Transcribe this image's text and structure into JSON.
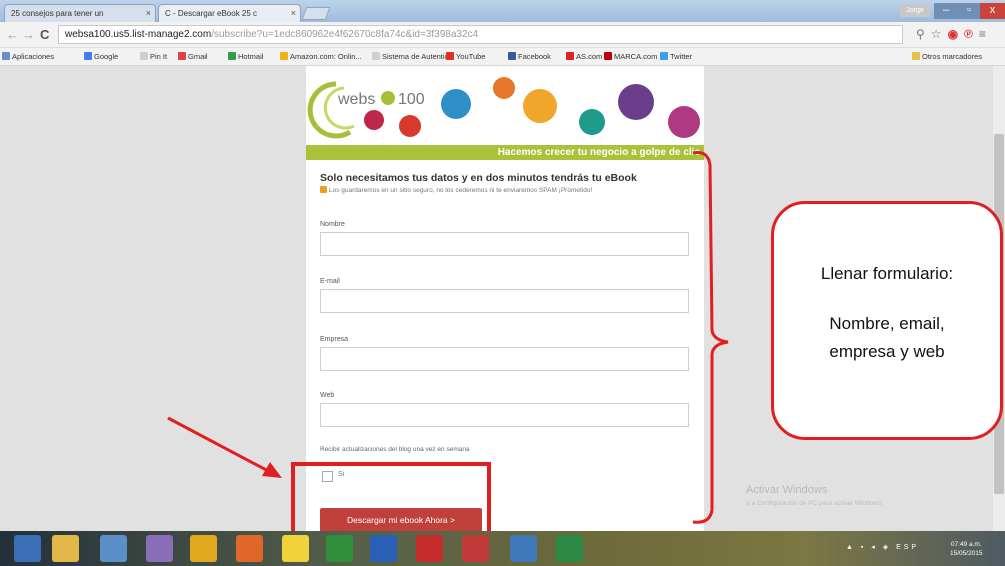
{
  "browser": {
    "tabs": [
      {
        "label": "25 consejos para tener un",
        "close": "×"
      },
      {
        "label": "C - Descargar eBook 25 c",
        "close": "×"
      }
    ],
    "window_user": "Jorge",
    "win_buttons": {
      "minimize": "–",
      "maximize": "▫",
      "close": "x"
    },
    "nav": {
      "back": "←",
      "forward": "→",
      "reload": "C"
    },
    "url_host": "websa100.us5.list-manage2.com",
    "url_path": "/subscribe?u=1edc860962e4f62670c8fa74c&id=3f398a32c4",
    "bookmarks": [
      {
        "label": "Aplicaciones",
        "color": "#6a8cc8"
      },
      {
        "label": "Google",
        "color": "#3f7ee8"
      },
      {
        "label": "Pin It",
        "color": "#cfcfcf"
      },
      {
        "label": "Gmail",
        "color": "#d44"
      },
      {
        "label": "Hotmail",
        "color": "#2f9e44"
      },
      {
        "label": "Amazon.com: Onlin...",
        "color": "#f2b019"
      },
      {
        "label": "Sistema de Autentic...",
        "color": "#cfcfcf"
      },
      {
        "label": "YouTube",
        "color": "#d32"
      },
      {
        "label": "Facebook",
        "color": "#3b5998"
      },
      {
        "label": "AS.com",
        "color": "#d22"
      },
      {
        "label": "MARCA.com",
        "color": "#b01"
      },
      {
        "label": "Twitter",
        "color": "#3aa0e8"
      }
    ],
    "other_bookmarks": "Otros marcadores"
  },
  "form": {
    "logo_text": "webs",
    "logo_text2": "100",
    "banner": "Hacemos crecer tu negocio a golpe de clic",
    "title": "Solo necesitamos tus datos y en dos minutos tendrás tu eBook",
    "subtitle": "Los guardaremos en un sitio seguro, no los cederemos ni te enviaremos SPAM ¡Prometido!",
    "fields": [
      {
        "label": "Nombre",
        "value": ""
      },
      {
        "label": "E-mail",
        "value": ""
      },
      {
        "label": "Empresa",
        "value": ""
      },
      {
        "label": "Web",
        "value": ""
      }
    ],
    "checkbox_label": "Recibir actualizaciones del blog una vez en semana",
    "checkbox_option": "Si",
    "submit": "Descargar mi ebook Ahora >"
  },
  "annotation": {
    "title": "Llenar formulario:",
    "line1": "Nombre, email,",
    "line2": "empresa y web",
    "color": "#e02020"
  },
  "watermark": {
    "title": "Activar Windows",
    "sub": "Ir a Configuración de PC para activar Windows."
  },
  "taskbar": {
    "tray_lang": "ESP",
    "time": "07:49 a.m.",
    "date": "15/05/2015"
  }
}
